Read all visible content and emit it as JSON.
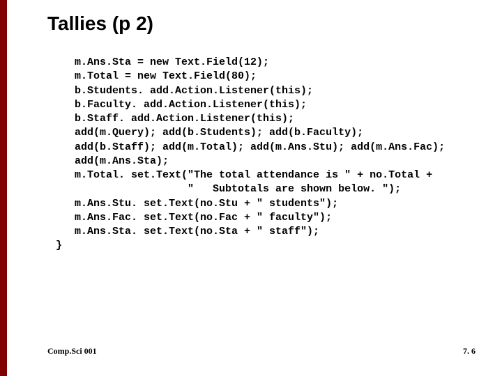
{
  "title": "Tallies (p 2)",
  "code": "   m.Ans.Sta = new Text.Field(12);\n   m.Total = new Text.Field(80);\n   b.Students. add.Action.Listener(this);\n   b.Faculty. add.Action.Listener(this);\n   b.Staff. add.Action.Listener(this);\n   add(m.Query); add(b.Students); add(b.Faculty);\n   add(b.Staff); add(m.Total); add(m.Ans.Stu); add(m.Ans.Fac);\n   add(m.Ans.Sta);\n   m.Total. set.Text(\"The total attendance is \" + no.Total +\n                     \"   Subtotals are shown below. \");\n   m.Ans.Stu. set.Text(no.Stu + \" students\");\n   m.Ans.Fac. set.Text(no.Fac + \" faculty\");\n   m.Ans.Sta. set.Text(no.Sta + \" staff\");\n}",
  "footer_left": "Comp.Sci 001",
  "footer_right": "7. 6"
}
